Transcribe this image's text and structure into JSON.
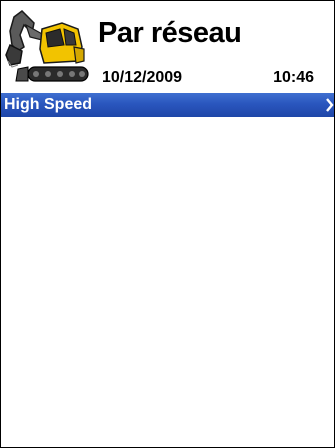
{
  "header": {
    "title": "Par réseau",
    "date": "10/12/2009",
    "time": "10:46",
    "logo_icon": "excavator-icon"
  },
  "list": {
    "items": [
      {
        "label": "High Speed",
        "icon": "chevron-right-icon"
      }
    ]
  },
  "colors": {
    "selection": "#2a56be",
    "excavator_body": "#f2c300"
  }
}
